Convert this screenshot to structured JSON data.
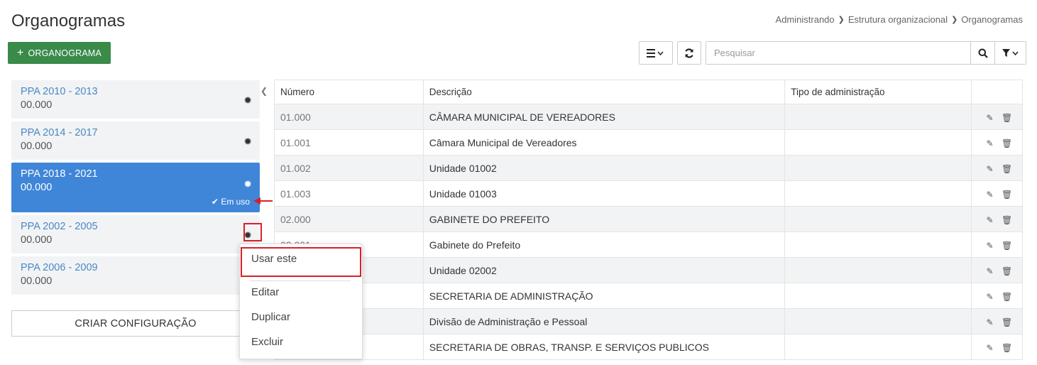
{
  "header": {
    "title": "Organogramas",
    "breadcrumb": [
      "Administrando",
      "Estrutura organizacional",
      "Organogramas"
    ],
    "add_button": "ORGANOGRAMA"
  },
  "toolbar": {
    "search_placeholder": "Pesquisar"
  },
  "configs": [
    {
      "name": "PPA 2010 - 2013",
      "code": "00.000"
    },
    {
      "name": "PPA 2014 - 2017",
      "code": "00.000"
    },
    {
      "name": "PPA 2018 - 2021",
      "code": "00.000",
      "active": true,
      "status": "Em uso"
    },
    {
      "name": "PPA 2002 - 2005",
      "code": "00.000"
    },
    {
      "name": "PPA 2006 - 2009",
      "code": "00.000"
    }
  ],
  "create_config_button": "CRIAR CONFIGURAÇÃO",
  "table": {
    "columns": [
      "Número",
      "Descrição",
      "Tipo de administração"
    ],
    "rows": [
      {
        "numero": "01.000",
        "descricao": "CÂMARA MUNICIPAL DE VEREADORES",
        "tipo": ""
      },
      {
        "numero": "01.001",
        "descricao": "Câmara Municipal de Vereadores",
        "tipo": ""
      },
      {
        "numero": "01.002",
        "descricao": "Unidade 01002",
        "tipo": ""
      },
      {
        "numero": "01.003",
        "descricao": "Unidade 01003",
        "tipo": ""
      },
      {
        "numero": "02.000",
        "descricao": "GABINETE DO PREFEITO",
        "tipo": ""
      },
      {
        "numero": "02.001",
        "descricao": "Gabinete do Prefeito",
        "tipo": ""
      },
      {
        "numero": "",
        "descricao": "Unidade 02002",
        "tipo": ""
      },
      {
        "numero": "",
        "descricao": "SECRETARIA DE ADMINISTRAÇÃO",
        "tipo": ""
      },
      {
        "numero": "",
        "descricao": "Divisão de Administração e Pessoal",
        "tipo": ""
      },
      {
        "numero": "",
        "descricao": "SECRETARIA DE OBRAS, TRANSP. E SERVIÇOS PUBLICOS",
        "tipo": ""
      }
    ]
  },
  "dropdown": {
    "items": [
      "Usar este",
      "Editar",
      "Duplicar",
      "Excluir"
    ]
  },
  "colors": {
    "primary": "#3a8a4a",
    "active": "#3f86d8",
    "link": "#4a88c6",
    "highlight": "#d9202a"
  }
}
